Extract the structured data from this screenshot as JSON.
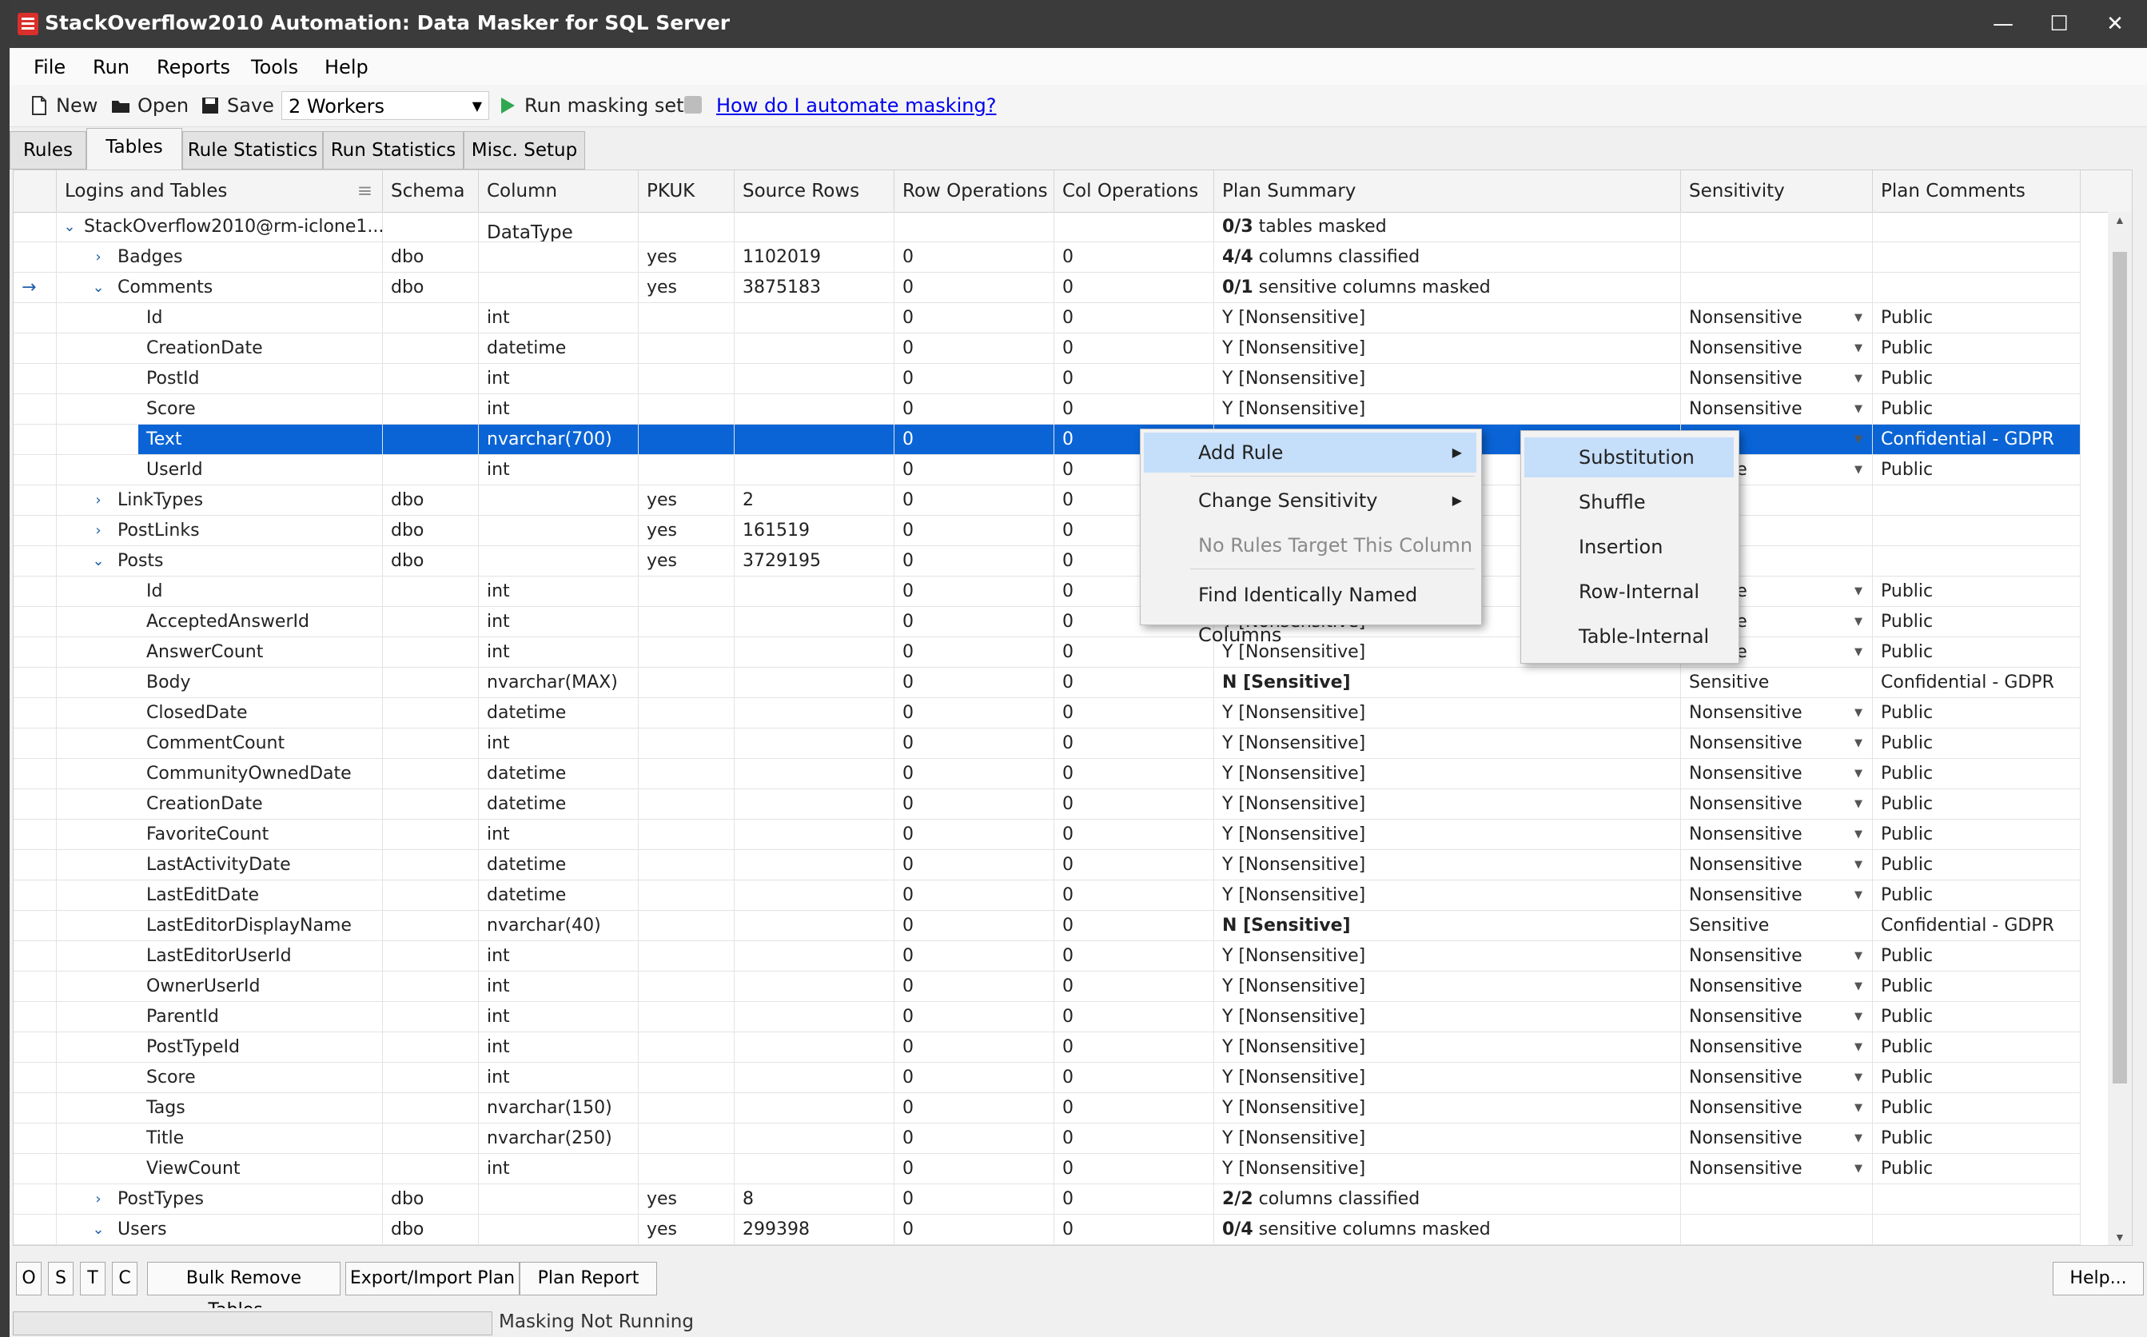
{
  "window": {
    "title": "StackOverflow2010 Automation: Data Masker for SQL Server"
  },
  "menu": [
    "File",
    "Run",
    "Reports",
    "Tools",
    "Help"
  ],
  "toolbar": {
    "new_label": "New",
    "open_label": "Open",
    "save_label": "Save",
    "workers": "2 Workers",
    "run_label": "Run masking set",
    "help_link": "How do I automate masking?"
  },
  "tabs": [
    {
      "label": "Rules"
    },
    {
      "label": "Tables"
    },
    {
      "label": "Rule Statistics"
    },
    {
      "label": "Run Statistics"
    },
    {
      "label": "Misc. Setup"
    }
  ],
  "columns": [
    "Logins and Tables",
    "Schema",
    "Column DataType",
    "PKUK",
    "Source Rows",
    "Row Operations",
    "Col Operations",
    "Plan Summary",
    "Sensitivity",
    "Plan Comments"
  ],
  "rows": [
    {
      "level": 0,
      "exp": "open",
      "name": "StackOverflow2010@rm-iclone1...",
      "schema": "",
      "dtype": "",
      "pkuk": "",
      "src": "",
      "rowops": "",
      "colops": "",
      "plan_b": "0/3",
      "plan": " tables masked",
      "sens": "",
      "comm": ""
    },
    {
      "level": 1,
      "exp": "closed",
      "name": "Badges",
      "schema": "dbo",
      "dtype": "",
      "pkuk": "yes",
      "src": "1102019",
      "rowops": "0",
      "colops": "0",
      "plan_b": "4/4",
      "plan": " columns classified",
      "sens": "",
      "comm": ""
    },
    {
      "level": 1,
      "exp": "open",
      "arrow": true,
      "name": "Comments",
      "schema": "dbo",
      "dtype": "",
      "pkuk": "yes",
      "src": "3875183",
      "rowops": "0",
      "colops": "0",
      "plan_b": "0/1",
      "plan": " sensitive columns masked",
      "sens": "",
      "comm": ""
    },
    {
      "level": 2,
      "name": "Id",
      "dtype": "int",
      "rowops": "0",
      "colops": "0",
      "plan": "Y [Nonsensitive]",
      "sens": "Nonsensitive",
      "dd": true,
      "comm": "Public"
    },
    {
      "level": 2,
      "name": "CreationDate",
      "dtype": "datetime",
      "rowops": "0",
      "colops": "0",
      "plan": "Y [Nonsensitive]",
      "sens": "Nonsensitive",
      "dd": true,
      "comm": "Public"
    },
    {
      "level": 2,
      "name": "PostId",
      "dtype": "int",
      "rowops": "0",
      "colops": "0",
      "plan": "Y [Nonsensitive]",
      "sens": "Nonsensitive",
      "dd": true,
      "comm": "Public"
    },
    {
      "level": 2,
      "name": "Score",
      "dtype": "int",
      "rowops": "0",
      "colops": "0",
      "plan": "Y [Nonsensitive]",
      "sens": "Nonsensitive",
      "dd": true,
      "comm": "Public"
    },
    {
      "level": 2,
      "sel": true,
      "name": "Text",
      "dtype": "nvarchar(700)",
      "rowops": "0",
      "colops": "0",
      "plan": "",
      "sens": "itive",
      "dd": true,
      "comm": "Confidential - GDPR"
    },
    {
      "level": 2,
      "name": "UserId",
      "dtype": "int",
      "rowops": "0",
      "colops": "0",
      "plan": "",
      "sens": "nsitive",
      "dd": true,
      "comm": "Public"
    },
    {
      "level": 1,
      "exp": "closed",
      "name": "LinkTypes",
      "schema": "dbo",
      "pkuk": "yes",
      "src": "2",
      "rowops": "0",
      "colops": "0",
      "plan": "",
      "sens": "",
      "comm": ""
    },
    {
      "level": 1,
      "exp": "closed",
      "name": "PostLinks",
      "schema": "dbo",
      "pkuk": "yes",
      "src": "161519",
      "rowops": "0",
      "colops": "0",
      "plan": "",
      "sens": "",
      "comm": ""
    },
    {
      "level": 1,
      "exp": "open",
      "name": "Posts",
      "schema": "dbo",
      "pkuk": "yes",
      "src": "3729195",
      "rowops": "0",
      "colops": "0",
      "plan": "",
      "sens": "",
      "comm": ""
    },
    {
      "level": 2,
      "name": "Id",
      "dtype": "int",
      "rowops": "0",
      "colops": "0",
      "plan": "",
      "sens": "nsitive",
      "dd": true,
      "comm": "Public"
    },
    {
      "level": 2,
      "name": "AcceptedAnswerId",
      "dtype": "int",
      "rowops": "0",
      "colops": "0",
      "plan": "Y [Nonsensitive]",
      "sens": "nsitive",
      "dd": true,
      "comm": "Public"
    },
    {
      "level": 2,
      "name": "AnswerCount",
      "dtype": "int",
      "rowops": "0",
      "colops": "0",
      "plan": "Y [Nonsensitive]",
      "sens": "nsitive",
      "dd": true,
      "comm": "Public"
    },
    {
      "level": 2,
      "name": "Body",
      "dtype": "nvarchar(MAX)",
      "rowops": "0",
      "colops": "0",
      "plan": "N [Sensitive]",
      "pb": true,
      "sens": "Sensitive",
      "dd": false,
      "comm": "Confidential - GDPR"
    },
    {
      "level": 2,
      "name": "ClosedDate",
      "dtype": "datetime",
      "rowops": "0",
      "colops": "0",
      "plan": "Y [Nonsensitive]",
      "sens": "Nonsensitive",
      "dd": true,
      "comm": "Public"
    },
    {
      "level": 2,
      "name": "CommentCount",
      "dtype": "int",
      "rowops": "0",
      "colops": "0",
      "plan": "Y [Nonsensitive]",
      "sens": "Nonsensitive",
      "dd": true,
      "comm": "Public"
    },
    {
      "level": 2,
      "name": "CommunityOwnedDate",
      "dtype": "datetime",
      "rowops": "0",
      "colops": "0",
      "plan": "Y [Nonsensitive]",
      "sens": "Nonsensitive",
      "dd": true,
      "comm": "Public"
    },
    {
      "level": 2,
      "name": "CreationDate",
      "dtype": "datetime",
      "rowops": "0",
      "colops": "0",
      "plan": "Y [Nonsensitive]",
      "sens": "Nonsensitive",
      "dd": true,
      "comm": "Public"
    },
    {
      "level": 2,
      "name": "FavoriteCount",
      "dtype": "int",
      "rowops": "0",
      "colops": "0",
      "plan": "Y [Nonsensitive]",
      "sens": "Nonsensitive",
      "dd": true,
      "comm": "Public"
    },
    {
      "level": 2,
      "name": "LastActivityDate",
      "dtype": "datetime",
      "rowops": "0",
      "colops": "0",
      "plan": "Y [Nonsensitive]",
      "sens": "Nonsensitive",
      "dd": true,
      "comm": "Public"
    },
    {
      "level": 2,
      "name": "LastEditDate",
      "dtype": "datetime",
      "rowops": "0",
      "colops": "0",
      "plan": "Y [Nonsensitive]",
      "sens": "Nonsensitive",
      "dd": true,
      "comm": "Public"
    },
    {
      "level": 2,
      "name": "LastEditorDisplayName",
      "dtype": "nvarchar(40)",
      "rowops": "0",
      "colops": "0",
      "plan": "N [Sensitive]",
      "pb": true,
      "sens": "Sensitive",
      "dd": false,
      "comm": "Confidential - GDPR"
    },
    {
      "level": 2,
      "name": "LastEditorUserId",
      "dtype": "int",
      "rowops": "0",
      "colops": "0",
      "plan": "Y [Nonsensitive]",
      "sens": "Nonsensitive",
      "dd": true,
      "comm": "Public"
    },
    {
      "level": 2,
      "name": "OwnerUserId",
      "dtype": "int",
      "rowops": "0",
      "colops": "0",
      "plan": "Y [Nonsensitive]",
      "sens": "Nonsensitive",
      "dd": true,
      "comm": "Public"
    },
    {
      "level": 2,
      "name": "ParentId",
      "dtype": "int",
      "rowops": "0",
      "colops": "0",
      "plan": "Y [Nonsensitive]",
      "sens": "Nonsensitive",
      "dd": true,
      "comm": "Public"
    },
    {
      "level": 2,
      "name": "PostTypeId",
      "dtype": "int",
      "rowops": "0",
      "colops": "0",
      "plan": "Y [Nonsensitive]",
      "sens": "Nonsensitive",
      "dd": true,
      "comm": "Public"
    },
    {
      "level": 2,
      "name": "Score",
      "dtype": "int",
      "rowops": "0",
      "colops": "0",
      "plan": "Y [Nonsensitive]",
      "sens": "Nonsensitive",
      "dd": true,
      "comm": "Public"
    },
    {
      "level": 2,
      "name": "Tags",
      "dtype": "nvarchar(150)",
      "rowops": "0",
      "colops": "0",
      "plan": "Y [Nonsensitive]",
      "sens": "Nonsensitive",
      "dd": true,
      "comm": "Public"
    },
    {
      "level": 2,
      "name": "Title",
      "dtype": "nvarchar(250)",
      "rowops": "0",
      "colops": "0",
      "plan": "Y [Nonsensitive]",
      "sens": "Nonsensitive",
      "dd": true,
      "comm": "Public"
    },
    {
      "level": 2,
      "name": "ViewCount",
      "dtype": "int",
      "rowops": "0",
      "colops": "0",
      "plan": "Y [Nonsensitive]",
      "sens": "Nonsensitive",
      "dd": true,
      "comm": "Public"
    },
    {
      "level": 1,
      "exp": "closed",
      "name": "PostTypes",
      "schema": "dbo",
      "pkuk": "yes",
      "src": "8",
      "rowops": "0",
      "colops": "0",
      "plan_b": "2/2",
      "plan": " columns classified",
      "sens": "",
      "comm": ""
    },
    {
      "level": 1,
      "exp": "open",
      "name": "Users",
      "schema": "dbo",
      "pkuk": "yes",
      "src": "299398",
      "rowops": "0",
      "colops": "0",
      "plan_b": "0/4",
      "plan": " sensitive columns masked",
      "sens": "",
      "comm": ""
    }
  ],
  "context_menu": {
    "add_rule": "Add Rule",
    "change_sensitivity": "Change Sensitivity",
    "no_rules": "No Rules Target This Column",
    "find_columns": "Find Identically Named Columns"
  },
  "submenu": [
    "Substitution",
    "Shuffle",
    "Insertion",
    "Row-Internal",
    "Table-Internal"
  ],
  "bottom_buttons": {
    "o": "O",
    "s": "S",
    "t": "T",
    "c": "C",
    "bulk_remove": "Bulk Remove Tables...",
    "export_import": "Export/Import Plan",
    "plan_report": "Plan Report",
    "help": "Help..."
  },
  "status": "Masking Not Running",
  "colors": {
    "selection": "#0a64d6",
    "menu_highlight": "#c5defa",
    "title_bar": "#3b3b3b"
  }
}
